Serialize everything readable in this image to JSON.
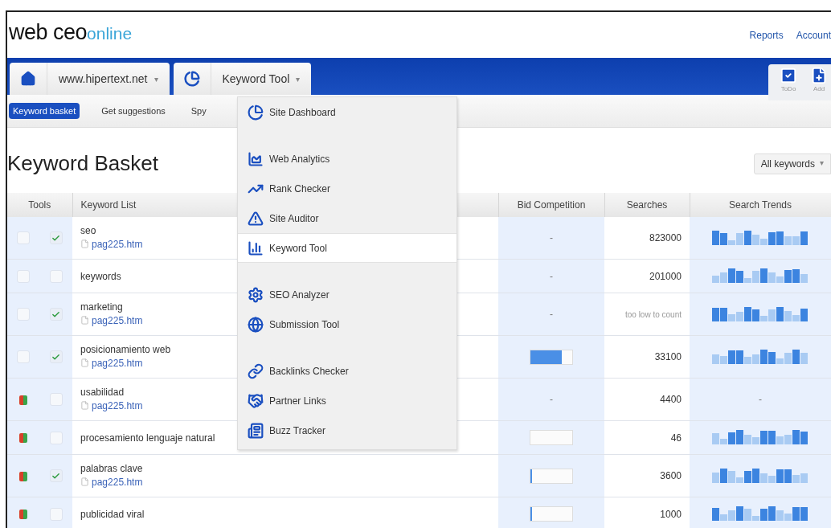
{
  "logo": {
    "main": "web ceo",
    "sub": "online"
  },
  "top_links": [
    "Reports",
    "Account"
  ],
  "nav": {
    "site": "www.hipertext.net",
    "tool": "Keyword Tool",
    "caret": "▾",
    "actions": [
      "ToDo",
      "Add"
    ]
  },
  "subnav": [
    {
      "label": "Keyword basket",
      "selected": true
    },
    {
      "label": "Get suggestions",
      "selected": false
    },
    {
      "label": "Spy",
      "selected": false
    }
  ],
  "title": "Keyword Basket",
  "filter": {
    "value": "All keywords",
    "caret": "▾"
  },
  "table": {
    "columns": [
      "Tools",
      "Keyword List",
      "Bid Competition",
      "Searches",
      "Search Trends"
    ],
    "rows": [
      {
        "marked": false,
        "checked": true,
        "keyword": "seo",
        "page": "pag225.htm",
        "bid": {
          "text": "-"
        },
        "searches": "823000",
        "trend": {
          "kind": "sparkline"
        }
      },
      {
        "marked": false,
        "checked": false,
        "keyword": "keywords",
        "bid": {
          "text": "-"
        },
        "searches": "201000",
        "trend": {
          "kind": "sparkline"
        }
      },
      {
        "marked": false,
        "checked": true,
        "keyword": "marketing",
        "page": "pag225.htm",
        "bid": {
          "text": "-"
        },
        "searches": "too low to count",
        "searches_faint": true,
        "trend": {
          "kind": "sparkline"
        }
      },
      {
        "marked": false,
        "checked": true,
        "keyword": "posicionamiento web",
        "page": "pag225.htm",
        "bid": {
          "level": 0.75
        },
        "searches": "33100",
        "trend": {
          "kind": "sparkline"
        }
      },
      {
        "marked": true,
        "checked": false,
        "keyword": "usabilidad",
        "page": "pag225.htm",
        "bid": {
          "text": "-"
        },
        "searches": "4400",
        "trend": {
          "kind": "text",
          "text": "-"
        }
      },
      {
        "marked": true,
        "checked": false,
        "keyword": "procesamiento lenguaje natural",
        "bid": {
          "level": 0
        },
        "searches": "46",
        "trend": {
          "kind": "sparkline"
        }
      },
      {
        "marked": true,
        "checked": true,
        "keyword": "palabras clave",
        "page": "pag225.htm",
        "bid": {
          "level": 0.03
        },
        "searches": "3600",
        "trend": {
          "kind": "sparkline"
        }
      },
      {
        "marked": true,
        "checked": false,
        "keyword": "publicidad viral",
        "bid": {
          "level": 0.03
        },
        "searches": "1000",
        "trend": {
          "kind": "sparkline"
        }
      }
    ]
  },
  "menu": {
    "groups": [
      {
        "items": [
          {
            "label": "Site Dashboard",
            "selected": false
          }
        ]
      },
      {
        "items": [
          {
            "label": "Web Analytics",
            "selected": false
          },
          {
            "label": "Rank Checker",
            "selected": false
          },
          {
            "label": "Site Auditor",
            "selected": false
          },
          {
            "label": "Keyword Tool",
            "selected": true
          }
        ]
      },
      {
        "items": [
          {
            "label": "SEO Analyzer",
            "selected": false
          },
          {
            "label": "Submission Tool",
            "selected": false
          }
        ]
      },
      {
        "items": [
          {
            "label": "Backlinks Checker",
            "selected": false
          },
          {
            "label": "Partner Links",
            "selected": false
          },
          {
            "label": "Buzz Tracker",
            "selected": false
          }
        ]
      }
    ]
  }
}
